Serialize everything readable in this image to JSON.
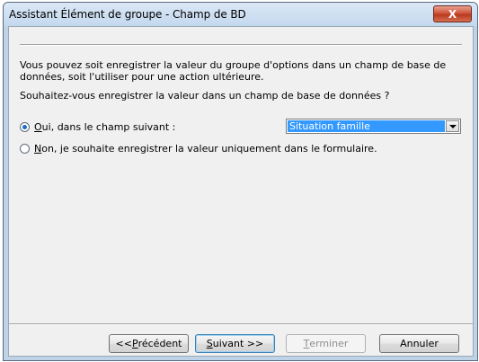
{
  "window": {
    "title": "Assistant Élément de groupe - Champ de BD",
    "close_glyph": "X"
  },
  "content": {
    "description": "Vous pouvez soit enregistrer la valeur du groupe d'options dans un champ de base de données, soit l'utiliser pour une action ultérieure.",
    "question": "Souhaitez-vous enregistrer la valeur dans un champ de base de données ?",
    "option_yes": {
      "accel": "O",
      "rest": "ui, dans le champ suivant :",
      "selected": true
    },
    "option_no": {
      "accel": "N",
      "rest": "on, je souhaite enregistrer la valeur uniquement dans le formulaire.",
      "selected": false
    },
    "field_select": {
      "value": "Situation famille"
    }
  },
  "buttons": {
    "previous": {
      "prefix": "<< ",
      "accel": "P",
      "rest": "récédent"
    },
    "next": {
      "accel": "S",
      "rest": "uivant >>"
    },
    "finish": {
      "accel": "T",
      "rest": "erminer"
    },
    "cancel": {
      "label": "Annuler"
    }
  },
  "colors": {
    "selection": "#3399ff",
    "radio_dot": "#1e6cc8",
    "close_button": "#c8452b"
  }
}
